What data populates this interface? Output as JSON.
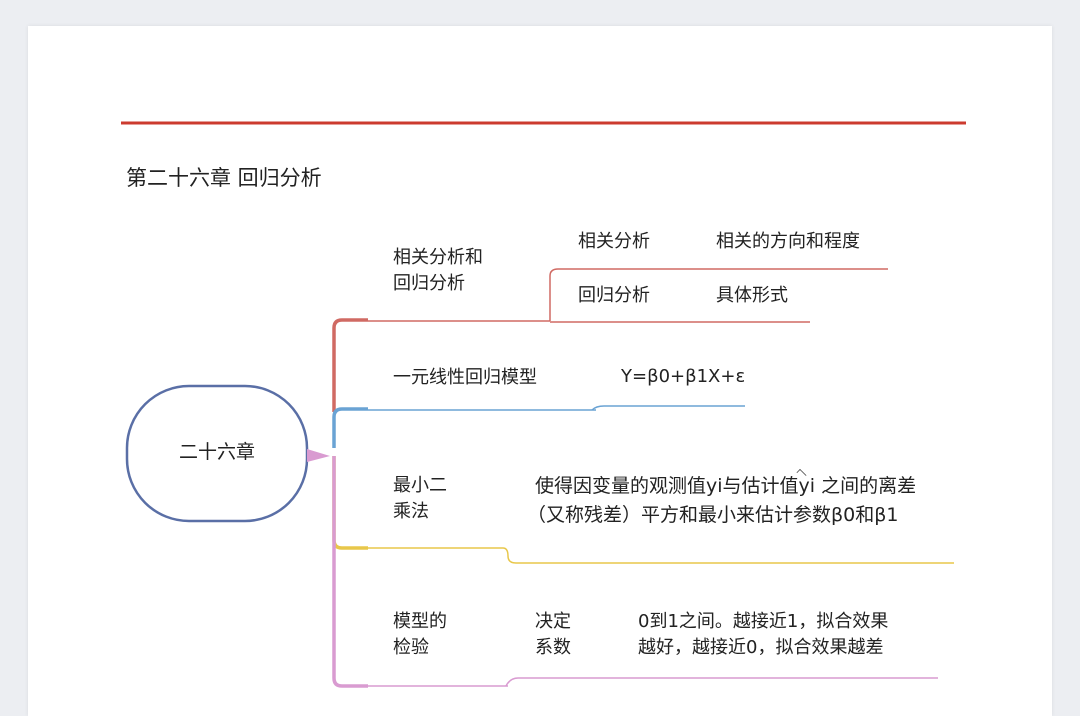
{
  "title": "第二十六章  回归分析",
  "colors": {
    "header_rule": "#cc3b2f",
    "root_border": "#5a6fa6",
    "branch_1": "#d06a63",
    "branch_2": "#6aa3d4",
    "branch_3": "#e8c74a",
    "branch_4": "#d99bd1"
  },
  "root": {
    "label": "二十六章"
  },
  "branches": [
    {
      "label": [
        "相关分析和",
        "回归分析"
      ],
      "children": [
        {
          "label": "相关分析",
          "detail": "相关的方向和程度"
        },
        {
          "label": "回归分析",
          "detail": "具体形式"
        }
      ]
    },
    {
      "label": [
        "一元线性回归模型"
      ],
      "detail": "Y=β0+β1X+ε"
    },
    {
      "label": [
        "最小二",
        "乘法"
      ],
      "detail": [
        "使得因变量的观测值yi与估计值",
        "yi",
        " 之间的离差",
        "（又称残差）平方和最小来估计参数β0和β1"
      ]
    },
    {
      "label": [
        "模型的",
        "检验"
      ],
      "children": [
        {
          "label": [
            "决定",
            "系数"
          ],
          "detail": [
            "0到1之间。越接近1，拟合效果",
            "越好，越接近0，拟合效果越差"
          ]
        }
      ]
    }
  ]
}
